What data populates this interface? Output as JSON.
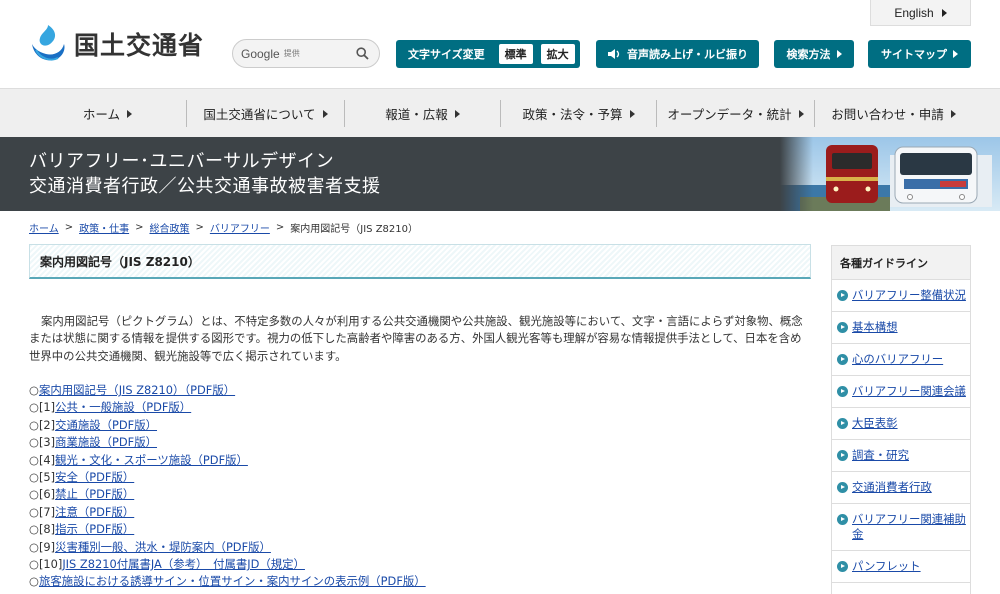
{
  "header": {
    "logo_text": "国土交通省",
    "search_brand": "Google",
    "search_sub": "提供",
    "english_label": "English",
    "font_size_label": "文字サイズ変更",
    "font_size_standard": "標準",
    "font_size_large": "拡大",
    "speech_label": "音声読み上げ・ルビ振り",
    "search_method_label": "検索方法",
    "sitemap_label": "サイトマップ"
  },
  "gnav": [
    {
      "label": "ホーム"
    },
    {
      "label": "国土交通省について"
    },
    {
      "label": "報道・広報"
    },
    {
      "label": "政策・法令・予算"
    },
    {
      "label": "オープンデータ・統計"
    },
    {
      "label": "お問い合わせ・申請"
    }
  ],
  "banner": {
    "line1": "バリアフリー･ユニバーサルデザイン",
    "line2": "交通消費者行政／公共交通事故被害者支援"
  },
  "breadcrumb": {
    "items": [
      "ホーム",
      "政策・仕事",
      "総合政策",
      "バリアフリー"
    ],
    "current": "案内用図記号（JIS Z8210）",
    "sep": ">"
  },
  "main": {
    "title": "案内用図記号（JIS Z8210）",
    "intro": "案内用図記号（ピクトグラム）とは、不特定多数の人々が利用する公共交通機関や公共施設、観光施設等において、文字・言語によらず対象物、概念または状態に関する情報を提供する図形です。視力の低下した高齢者や障害のある方、外国人観光客等も理解が容易な情報提供手法として、日本を含め世界中の公共交通機関、観光施設等で広く掲示されています。",
    "links": [
      {
        "prefix": "○",
        "text": "案内用図記号（JIS Z8210）（PDF版）"
      },
      {
        "prefix": "○[1]",
        "text": "公共・一般施設（PDF版）"
      },
      {
        "prefix": "○[2]",
        "text": "交通施設（PDF版）"
      },
      {
        "prefix": "○[3]",
        "text": "商業施設（PDF版）"
      },
      {
        "prefix": "○[4]",
        "text": "観光・文化・スポーツ施設（PDF版）"
      },
      {
        "prefix": "○[5]",
        "text": "安全（PDF版）"
      },
      {
        "prefix": "○[6]",
        "text": "禁止（PDF版）"
      },
      {
        "prefix": "○[7]",
        "text": "注意（PDF版）"
      },
      {
        "prefix": "○[8]",
        "text": "指示（PDF版）"
      },
      {
        "prefix": "○[9]",
        "text": "災害種別一般、洪水・堤防案内（PDF版）"
      },
      {
        "prefix": "○[10]",
        "text": "JIS Z8210付属書JA（参考）　付属書JD（規定）"
      },
      {
        "prefix": "○",
        "text": "旅客施設における誘導サイン・位置サイン・案内サインの表示例（PDF版）"
      }
    ]
  },
  "side": {
    "heading": "各種ガイドライン",
    "items": [
      {
        "label": "バリアフリー整備状況"
      },
      {
        "label": "基本構想"
      },
      {
        "label": "心のバリアフリー"
      },
      {
        "label": "バリアフリー関連会議"
      },
      {
        "label": "大臣表彰"
      },
      {
        "label": "調査・研究"
      },
      {
        "label": "交通消費者行政"
      },
      {
        "label": "バリアフリー関連補助金"
      },
      {
        "label": "パンフレット"
      }
    ]
  },
  "colors": {
    "accent": "#006e82",
    "banner_bg": "#3d4347",
    "link": "#1a4aa8"
  }
}
